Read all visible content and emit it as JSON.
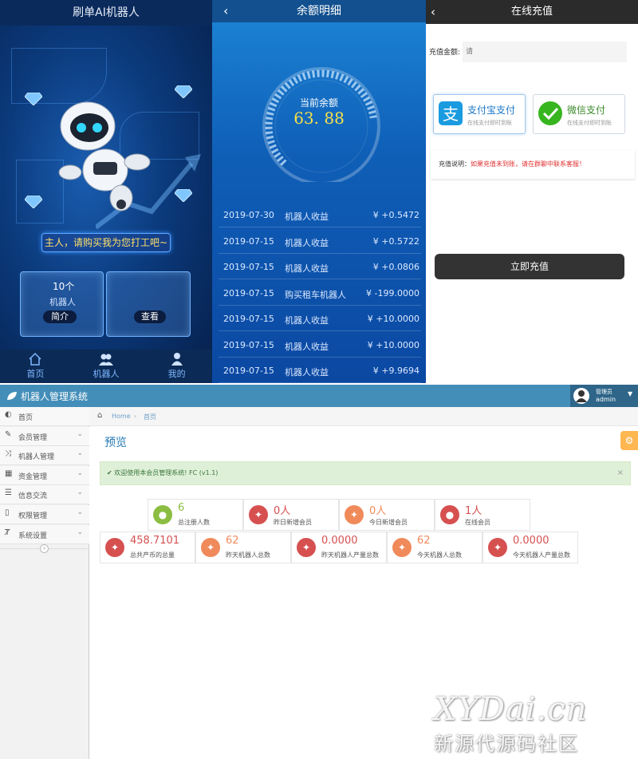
{
  "robot_app": {
    "title": "刷单AI机器人",
    "slogan": "主人，请购买我为您打工吧~",
    "card_count": "10个",
    "card_name": "机器人",
    "intro_button": "简介",
    "view_button": "查看",
    "tabs": [
      {
        "label": "首页",
        "icon": "home-icon"
      },
      {
        "label": "机器人",
        "icon": "users-icon"
      },
      {
        "label": "我的",
        "icon": "user-icon"
      }
    ]
  },
  "balance": {
    "title": "余额明细",
    "current_label": "当前余额",
    "current_value": "63. 88",
    "gauge_level_percent": 80,
    "rows": [
      {
        "date": "2019-07-30",
        "desc": "机器人收益",
        "amount": "¥ +0.5472"
      },
      {
        "date": "2019-07-15",
        "desc": "机器人收益",
        "amount": "¥ +0.5722"
      },
      {
        "date": "2019-07-15",
        "desc": "机器人收益",
        "amount": "¥ +0.0806"
      },
      {
        "date": "2019-07-15",
        "desc": "购买租车机器人",
        "amount": "¥ -199.0000"
      },
      {
        "date": "2019-07-15",
        "desc": "机器人收益",
        "amount": "¥ +10.0000"
      },
      {
        "date": "2019-07-15",
        "desc": "机器人收益",
        "amount": "¥ +10.0000"
      },
      {
        "date": "2019-07-15",
        "desc": "机器人收益",
        "amount": "¥ +9.9694"
      }
    ]
  },
  "recharge": {
    "title": "在线充值",
    "amount_label": "充值金额:",
    "amount_placeholder": "请",
    "alipay_title": "支付宝支付",
    "alipay_sub": "在线支付即时到账",
    "wechat_title": "微信支付",
    "wechat_sub": "在线支付即时到账",
    "note_label": "充值说明：",
    "note_text": "如果充值未到账，请在群聊中联系客服！",
    "submit_label": "立即充值"
  },
  "admin": {
    "system_title": "机器人管理系统",
    "user_role": "管理员",
    "user_name": "admin",
    "menu": [
      {
        "label": "首页",
        "icon": "dashboard-icon",
        "has_arrow": false
      },
      {
        "label": "会员管理",
        "icon": "edit-icon",
        "has_arrow": true
      },
      {
        "label": "机器人管理",
        "icon": "shuffle-icon",
        "has_arrow": true
      },
      {
        "label": "资金管理",
        "icon": "calendar-icon",
        "has_arrow": true
      },
      {
        "label": "信息交流",
        "icon": "list-icon",
        "has_arrow": true
      },
      {
        "label": "权限管理",
        "icon": "file-icon",
        "has_arrow": true
      },
      {
        "label": "系统设置",
        "icon": "text-icon",
        "has_arrow": true
      }
    ],
    "breadcrumb": {
      "home": "Home",
      "current": "首页"
    },
    "page_title": "预览",
    "welcome_text": "欢迎使用本会员管理系统! FC (v1.1)",
    "stats_row1": [
      {
        "value": "6",
        "label": "总注册人数",
        "color": "#8bbd42"
      },
      {
        "value": "0人",
        "label": "昨日新增会员",
        "color": "#d65050"
      },
      {
        "value": "0人",
        "label": "今日新增会员",
        "color": "#f08a5a"
      },
      {
        "value": "1人",
        "label": "在线会员",
        "color": "#d65050"
      }
    ],
    "stats_row2": [
      {
        "value": "458.7101",
        "label": "总共产币的总量",
        "color": "#d65050"
      },
      {
        "value": "62",
        "label": "昨天机器人总数",
        "color": "#f08a5a"
      },
      {
        "value": "0.0000",
        "label": "昨天机器人产量总数",
        "color": "#d65050"
      },
      {
        "value": "62",
        "label": "今天机器人总数",
        "color": "#f08a5a"
      },
      {
        "value": "0.0000",
        "label": "今天机器人产量总数",
        "color": "#d65050"
      }
    ]
  },
  "watermark": {
    "line1": "XYDai.cn",
    "line2": "新源代源码社区"
  }
}
